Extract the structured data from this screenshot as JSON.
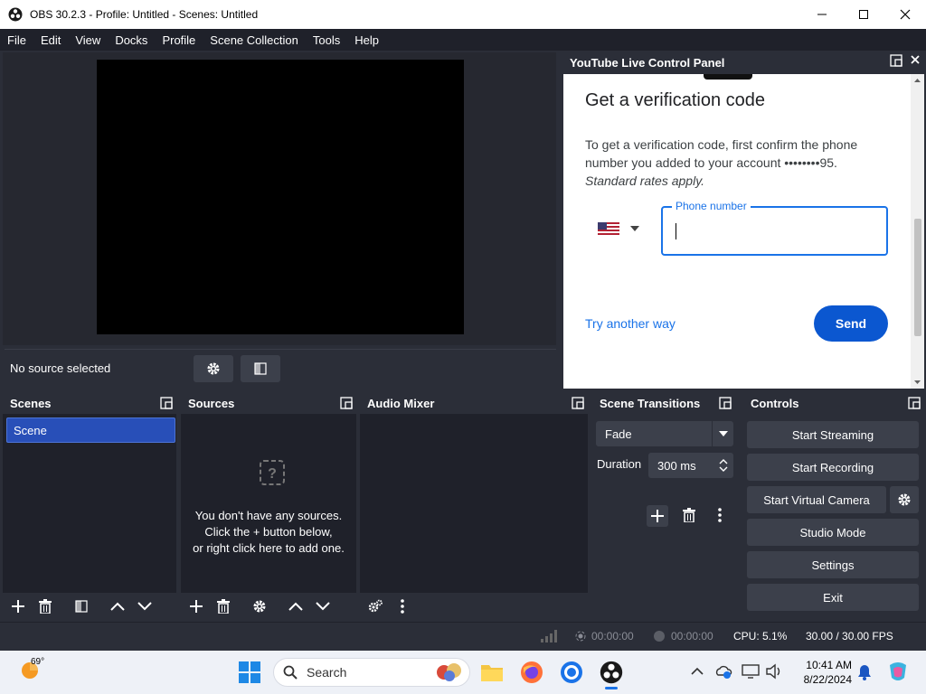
{
  "window": {
    "title": "OBS 30.2.3 - Profile: Untitled - Scenes: Untitled"
  },
  "menu": [
    "File",
    "Edit",
    "View",
    "Docks",
    "Profile",
    "Scene Collection",
    "Tools",
    "Help"
  ],
  "source_toolbar": {
    "no_source": "No source selected"
  },
  "youtube": {
    "panel_title": "YouTube Live Control Panel",
    "heading": "Get a verification code",
    "desc_line1": "To get a verification code, first confirm the phone",
    "desc_line2": "number you added to your account ••••••••95.",
    "desc_line3": "Standard rates apply.",
    "phone_label": "Phone number",
    "phone_value": "",
    "try_another": "Try another way",
    "send": "Send"
  },
  "scenes": {
    "title": "Scenes",
    "items": [
      "Scene"
    ]
  },
  "sources": {
    "title": "Sources",
    "empty_line1": "You don't have any sources.",
    "empty_line2": "Click the + button below,",
    "empty_line3": "or right click here to add one."
  },
  "audio_mixer": {
    "title": "Audio Mixer"
  },
  "transitions": {
    "title": "Scene Transitions",
    "selected": "Fade",
    "duration_label": "Duration",
    "duration_value": "300 ms"
  },
  "controls": {
    "title": "Controls",
    "start_streaming": "Start Streaming",
    "start_recording": "Start Recording",
    "start_virtual_camera": "Start Virtual Camera",
    "studio_mode": "Studio Mode",
    "settings": "Settings",
    "exit": "Exit"
  },
  "status": {
    "stream_time": "00:00:00",
    "record_time": "00:00:00",
    "cpu": "CPU: 5.1%",
    "fps": "30.00 / 30.00 FPS"
  },
  "taskbar": {
    "temperature": "69°",
    "search_placeholder": "Search",
    "time": "10:41 AM",
    "date": "8/22/2024"
  },
  "colors": {
    "accent": "#284fb8",
    "obs_bg": "#2b2e38",
    "dock_bg": "#1f212a",
    "button": "#3c404b",
    "google_blue": "#1a73e8",
    "send_blue": "#0b57d0"
  }
}
